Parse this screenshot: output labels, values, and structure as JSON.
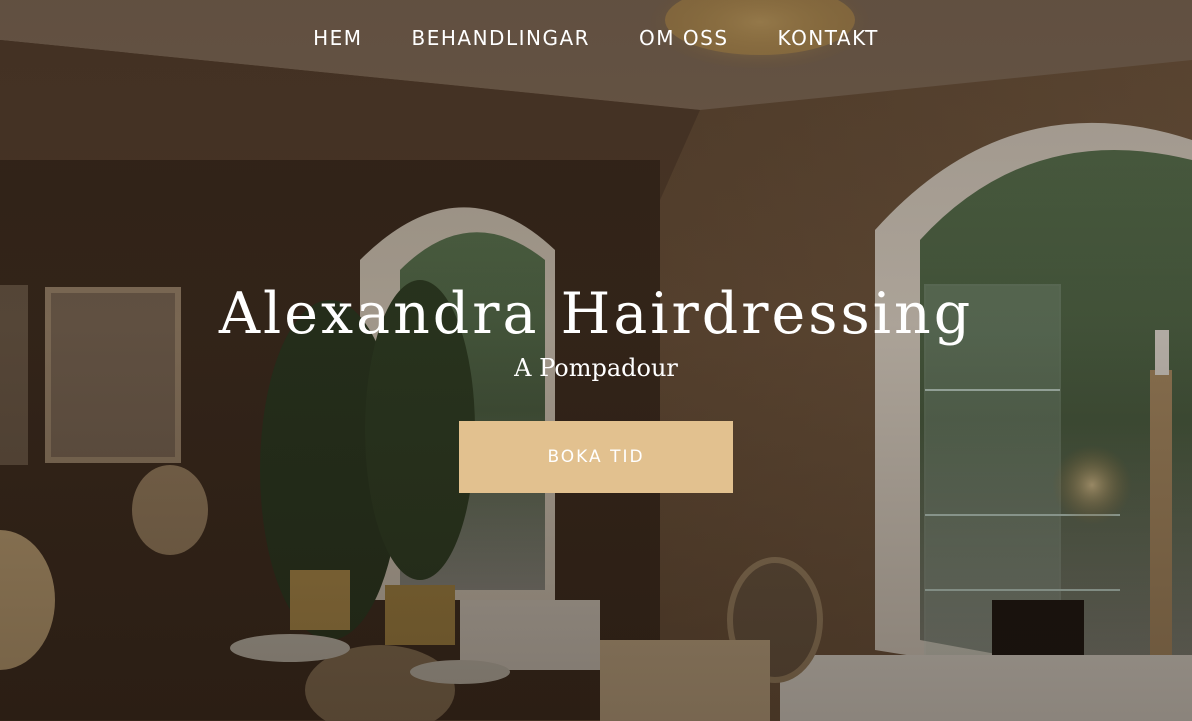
{
  "nav": {
    "items": [
      {
        "label": "HEM"
      },
      {
        "label": "BEHANDLINGAR"
      },
      {
        "label": "OM OSS"
      },
      {
        "label": "KONTAKT"
      }
    ]
  },
  "hero": {
    "title": "Alexandra Hairdressing",
    "subtitle": "A Pompadour",
    "cta_label": "BOKA TID",
    "background_image": "salon-interior"
  },
  "colors": {
    "nav_text": "#ffffff",
    "title_text": "#ffffff",
    "cta_background": "#e2c18f",
    "cta_text": "#ffffff"
  }
}
